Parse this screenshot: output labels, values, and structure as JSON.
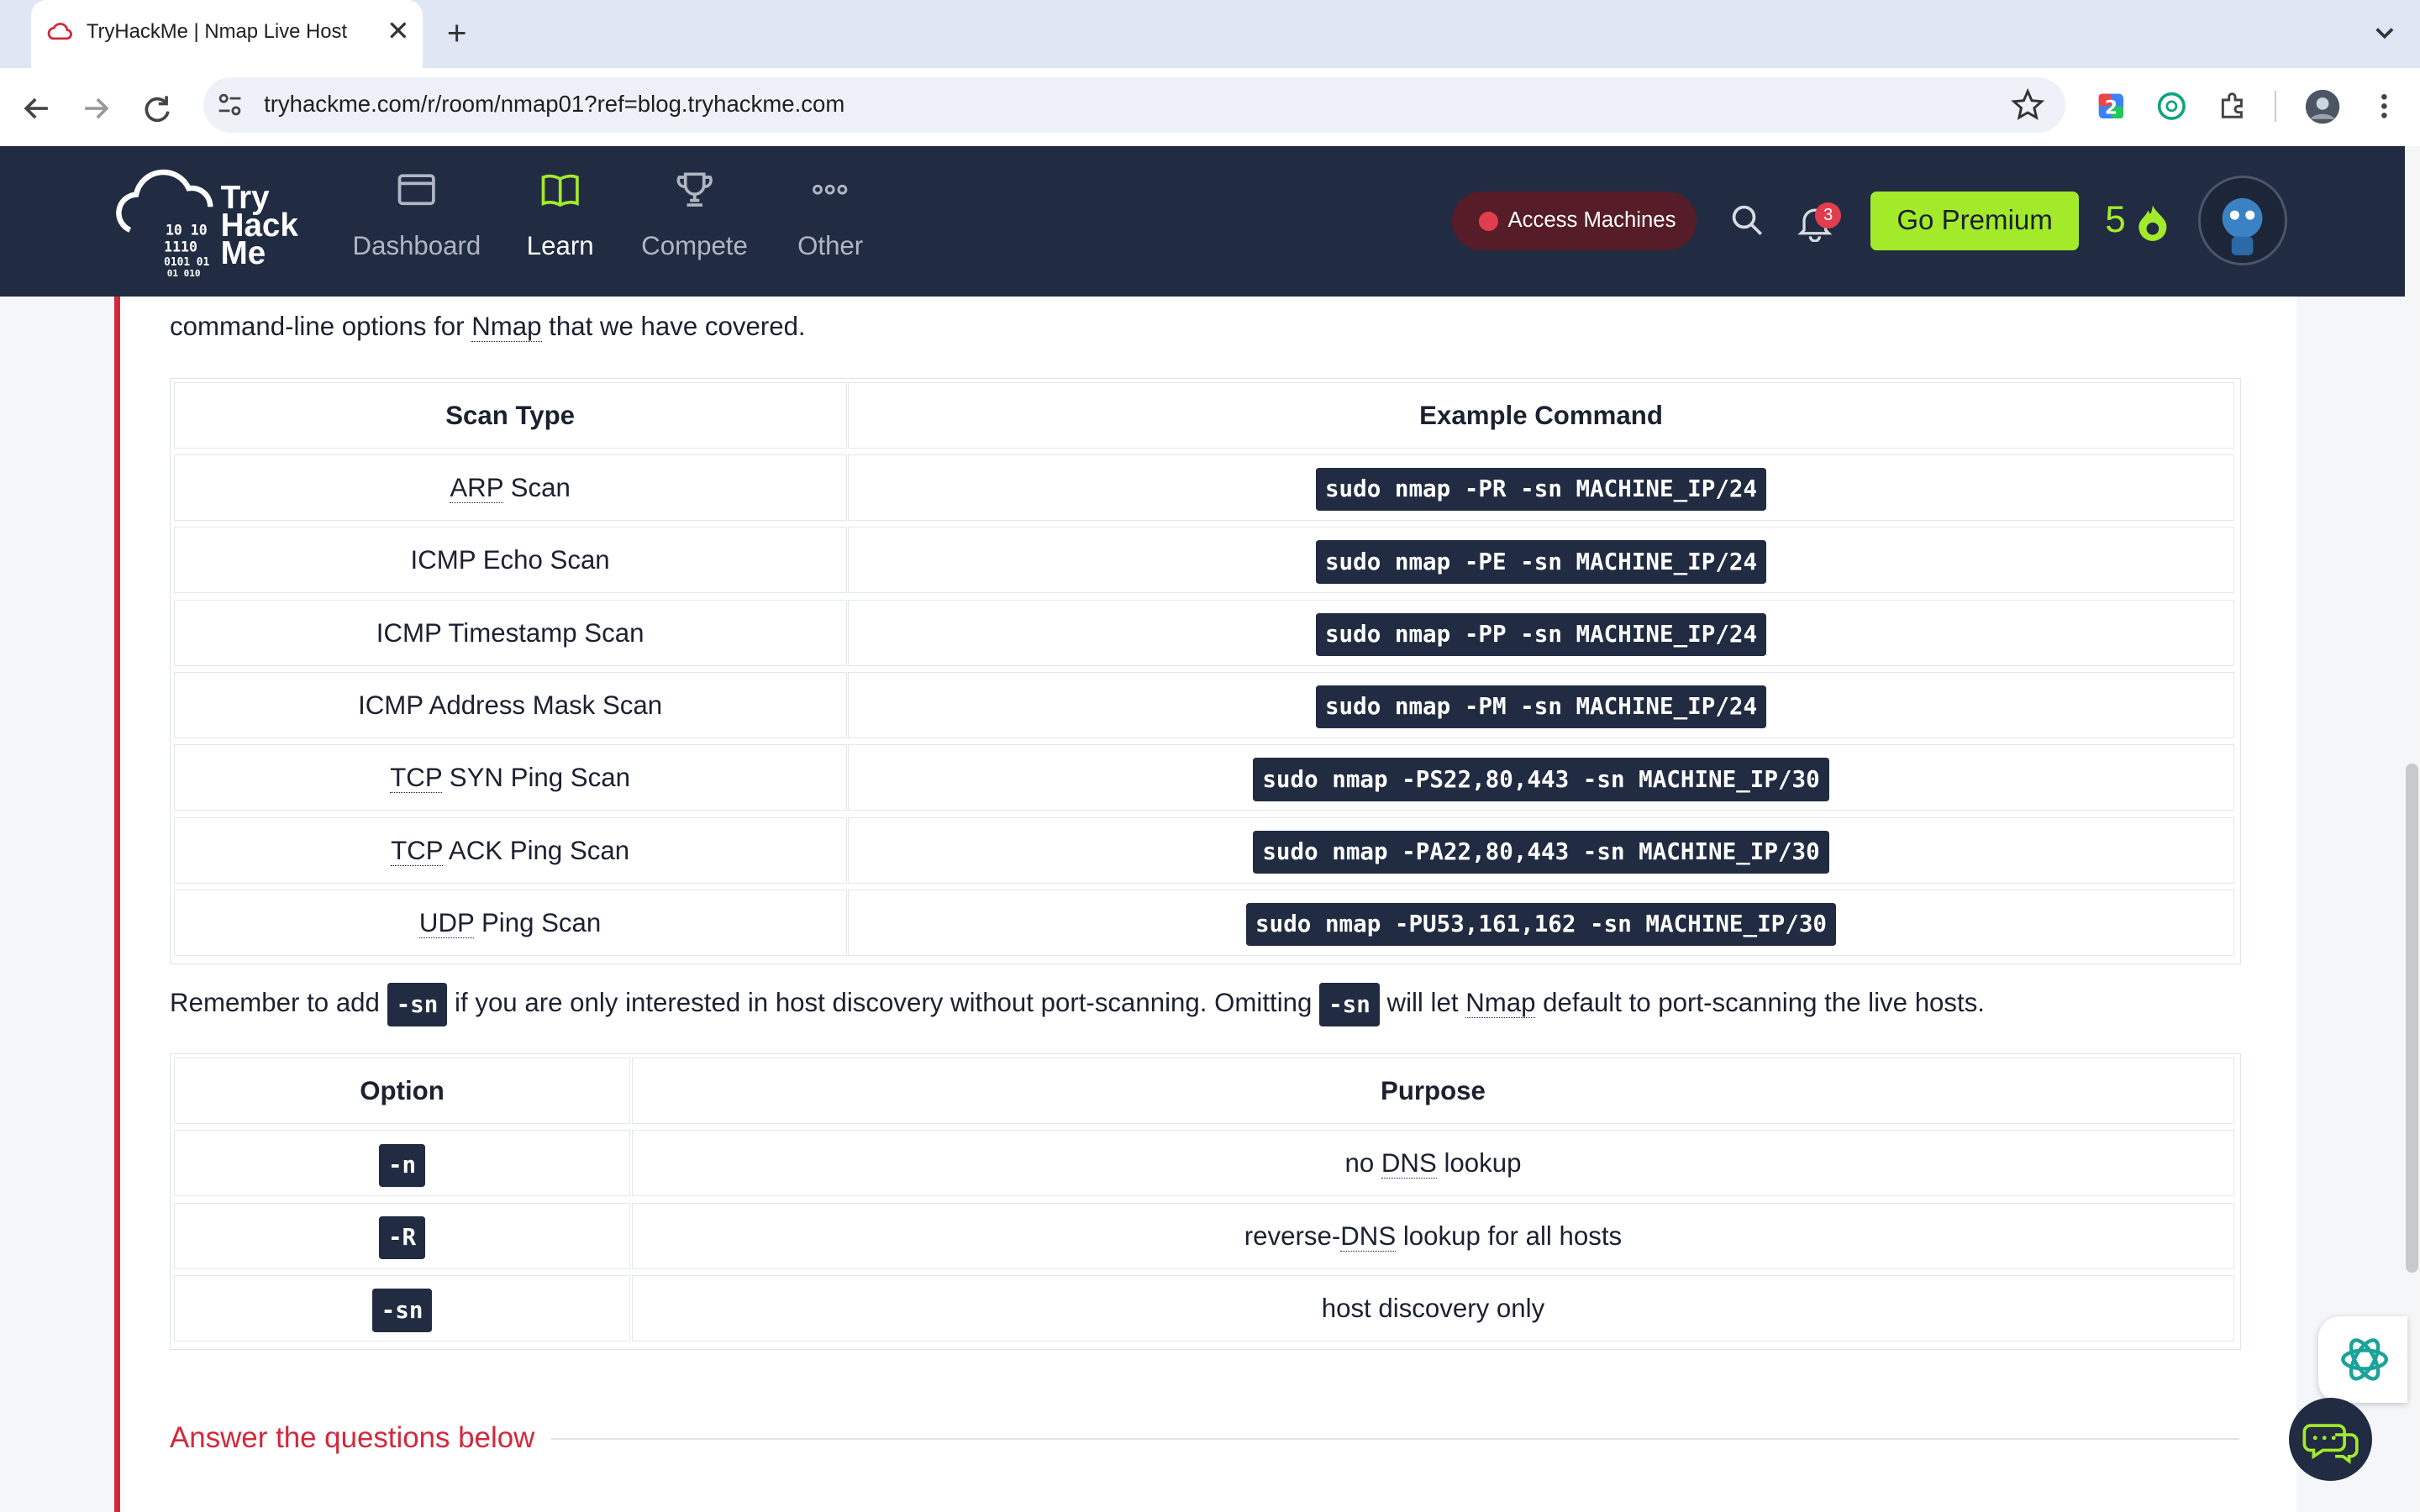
{
  "browser": {
    "tab_title": "TryHackMe | Nmap Live Host",
    "url": "tryhackme.com/r/room/nmap01?ref=blog.tryhackme.com"
  },
  "header": {
    "logo_text": [
      "Try",
      "Hack",
      "Me"
    ],
    "nav": [
      {
        "label": "Dashboard",
        "icon": "dashboard-icon"
      },
      {
        "label": "Learn",
        "icon": "book-icon",
        "active": true
      },
      {
        "label": "Compete",
        "icon": "trophy-icon"
      },
      {
        "label": "Other",
        "icon": "more-icon"
      }
    ],
    "access_label": "Access Machines",
    "notifications": "3",
    "premium_label": "Go Premium",
    "streak": "5",
    "colors": {
      "header_bg": "#212c42",
      "accent_green": "#a3ea2a",
      "accent_red": "#d3283c"
    }
  },
  "content": {
    "intro_pre": "command-line options for ",
    "intro_abbr": "Nmap",
    "intro_post": " that we have covered.",
    "scan_table": {
      "headers": [
        "Scan Type",
        "Example Command"
      ],
      "rows": [
        {
          "type_abbr": "ARP",
          "type_rest": " Scan",
          "command": "sudo nmap -PR -sn MACHINE_IP/24"
        },
        {
          "type_abbr": "",
          "type_rest": "ICMP Echo Scan",
          "command": "sudo nmap -PE -sn MACHINE_IP/24"
        },
        {
          "type_abbr": "",
          "type_rest": "ICMP Timestamp Scan",
          "command": "sudo nmap -PP -sn MACHINE_IP/24"
        },
        {
          "type_abbr": "",
          "type_rest": "ICMP Address Mask Scan",
          "command": "sudo nmap -PM -sn MACHINE_IP/24"
        },
        {
          "type_abbr": "TCP",
          "type_rest": " SYN Ping Scan",
          "command": "sudo nmap -PS22,80,443 -sn MACHINE_IP/30"
        },
        {
          "type_abbr": "TCP",
          "type_rest": " ACK Ping Scan",
          "command": "sudo nmap -PA22,80,443 -sn MACHINE_IP/30"
        },
        {
          "type_abbr": "UDP",
          "type_rest": " Ping Scan",
          "command": "sudo nmap -PU53,161,162 -sn MACHINE_IP/30"
        }
      ]
    },
    "remember": {
      "part1": "Remember to add ",
      "code1": "-sn",
      "part2": " if you are only interested in host discovery without port-scanning. Omitting ",
      "code2": "-sn",
      "part3": " will let ",
      "abbr": "Nmap",
      "part4": " default to port-scanning the live hosts."
    },
    "option_table": {
      "headers": [
        "Option",
        "Purpose"
      ],
      "rows": [
        {
          "option": "-n",
          "purpose_pre": "no ",
          "purpose_abbr": "DNS",
          "purpose_post": " lookup"
        },
        {
          "option": "-R",
          "purpose_pre": "reverse-",
          "purpose_abbr": "DNS",
          "purpose_post": " lookup for all hosts"
        },
        {
          "option": "-sn",
          "purpose_pre": "host discovery only",
          "purpose_abbr": "",
          "purpose_post": ""
        }
      ]
    },
    "answer_heading": "Answer the questions below"
  }
}
